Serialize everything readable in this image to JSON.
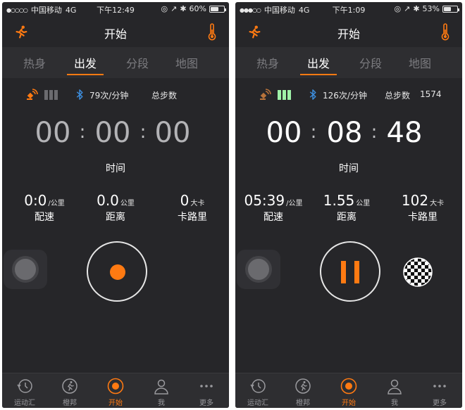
{
  "theme": {
    "accent": "#ff7a12",
    "background": "#262629",
    "gps_on": "#9ff2a8"
  },
  "screens": [
    {
      "status": {
        "signal": "●○○○○",
        "carrier": "中国移动",
        "network": "4G",
        "time": "下午12:49",
        "battery": "60%",
        "battery_level": 0.6
      },
      "nav": {
        "title": "开始",
        "left_icon": "runner-icon",
        "right_icon": "thermometer-icon"
      },
      "tabs": [
        {
          "label": "热身"
        },
        {
          "label": "出发"
        },
        {
          "label": "分段"
        },
        {
          "label": "地图"
        }
      ],
      "active_tab": 1,
      "sensors": {
        "gps_bars_active": 0,
        "cadence": "79次/分钟",
        "steps_label": "总步数",
        "steps_value": ""
      },
      "timer": {
        "hours": "00",
        "minutes": "00",
        "seconds": "00",
        "label": "时间"
      },
      "metrics": {
        "pace": {
          "value": "0:0",
          "unit": "/公里",
          "label": "配速"
        },
        "distance": {
          "value": "0.0",
          "unit": "公里",
          "label": "距离"
        },
        "calories": {
          "value": "0",
          "unit": "大卡",
          "label": "卡路里"
        }
      },
      "controls": {
        "state": "idle",
        "main_icon": "record-icon"
      },
      "bottom_nav": [
        {
          "label": "运动汇",
          "icon": "history-clock-icon"
        },
        {
          "label": "橙邦",
          "icon": "runner-circle-icon"
        },
        {
          "label": "开始",
          "icon": "start-circle-icon"
        },
        {
          "label": "我",
          "icon": "person-icon"
        },
        {
          "label": "更多",
          "icon": "more-dots-icon"
        }
      ],
      "active_bottom": 2
    },
    {
      "status": {
        "signal": "●●●○○",
        "carrier": "中国移动",
        "network": "4G",
        "time": "下午1:09",
        "battery": "53%",
        "battery_level": 0.53
      },
      "nav": {
        "title": "开始",
        "left_icon": "runner-icon",
        "right_icon": "thermometer-icon"
      },
      "tabs": [
        {
          "label": "热身"
        },
        {
          "label": "出发"
        },
        {
          "label": "分段"
        },
        {
          "label": "地图"
        }
      ],
      "active_tab": 1,
      "sensors": {
        "gps_bars_active": 3,
        "cadence": "126次/分钟",
        "steps_label": "总步数",
        "steps_value": "1574"
      },
      "timer": {
        "hours": "00",
        "minutes": "08",
        "seconds": "48",
        "label": "时间"
      },
      "metrics": {
        "pace": {
          "value": "05:39",
          "unit": "/公里",
          "label": "配速"
        },
        "distance": {
          "value": "1.55",
          "unit": "公里",
          "label": "距离"
        },
        "calories": {
          "value": "102",
          "unit": "大卡",
          "label": "卡路里"
        }
      },
      "controls": {
        "state": "running",
        "main_icon": "pause-icon",
        "finish_icon": "checkered-flag-icon"
      },
      "bottom_nav": [
        {
          "label": "运动汇",
          "icon": "history-clock-icon"
        },
        {
          "label": "橙邦",
          "icon": "runner-circle-icon"
        },
        {
          "label": "开始",
          "icon": "start-circle-icon"
        },
        {
          "label": "我",
          "icon": "person-icon"
        },
        {
          "label": "更多",
          "icon": "more-dots-icon"
        }
      ],
      "active_bottom": 2
    }
  ]
}
